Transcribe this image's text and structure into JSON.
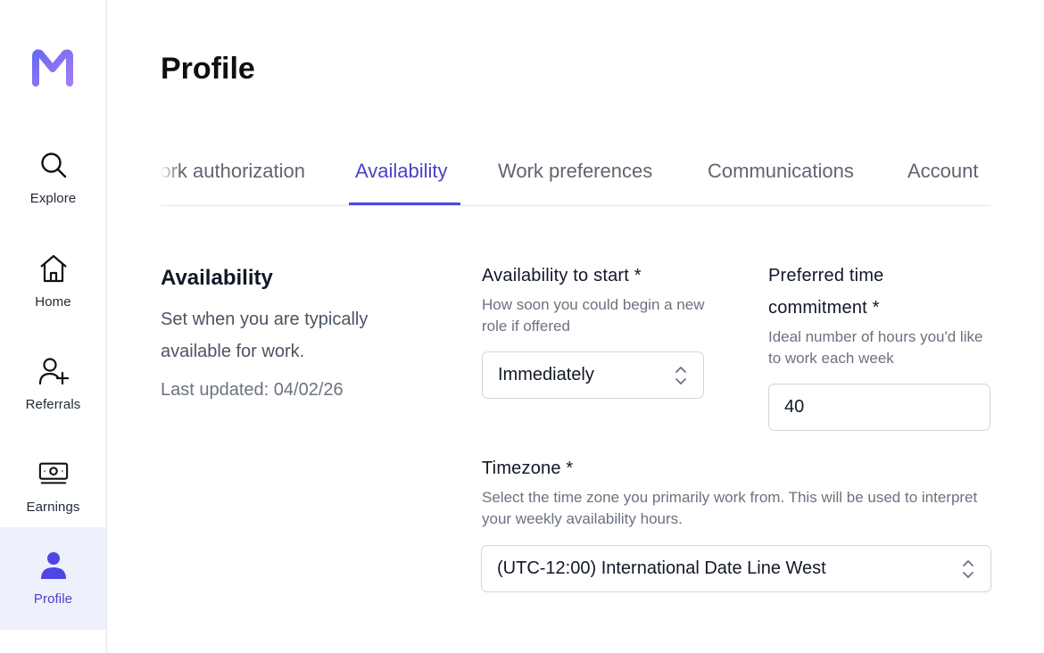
{
  "sidebar": {
    "logo": "M",
    "items": [
      {
        "label": "Explore",
        "icon": "search-icon"
      },
      {
        "label": "Home",
        "icon": "home-icon"
      },
      {
        "label": "Referrals",
        "icon": "user-plus-icon"
      },
      {
        "label": "Earnings",
        "icon": "cash-icon"
      },
      {
        "label": "Profile",
        "icon": "user-icon",
        "active": true
      }
    ]
  },
  "page": {
    "title": "Profile"
  },
  "tabs": [
    {
      "label": "Work authorization"
    },
    {
      "label": "Availability",
      "active": true
    },
    {
      "label": "Work preferences"
    },
    {
      "label": "Communications"
    },
    {
      "label": "Account"
    }
  ],
  "section": {
    "title": "Availability",
    "description": "Set when you are typically available for work.",
    "last_updated": "Last updated: 04/02/26"
  },
  "fields": {
    "availability_start": {
      "label": "Availability to start *",
      "help": "How soon you could begin a new role if offered",
      "value": "Immediately"
    },
    "time_commitment": {
      "label": "Preferred time commitment *",
      "help": "Ideal number of hours you'd like to work each week",
      "value": "40"
    },
    "timezone": {
      "label": "Timezone *",
      "help": "Select the time zone you primarily work from. This will be used to interpret your weekly availability hours.",
      "value": "(UTC-12:00) International Date Line West"
    }
  },
  "colors": {
    "accent": "#4f46e5",
    "active_nav_bg": "#eef0fc",
    "logo_gradient_start": "#6d6cf5",
    "logo_gradient_end": "#9b7cf2"
  }
}
